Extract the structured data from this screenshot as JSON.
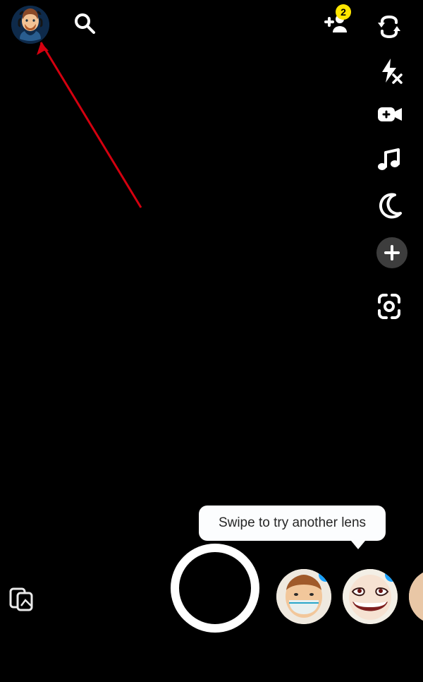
{
  "topbar": {
    "notification_count": "2"
  },
  "icons": {
    "search": "search-icon",
    "add_friend": "add-friend-icon",
    "flip": "flip-camera-icon",
    "flash": "flash-off-icon",
    "video": "video-plus-icon",
    "music": "music-icon",
    "night": "night-mode-icon",
    "plus": "plus-icon",
    "scan": "scan-icon",
    "memories": "memories-icon"
  },
  "tooltip": {
    "text": "Swipe to try another lens"
  },
  "lenses": [
    {
      "name": "face-mask-lens",
      "has_badge": true
    },
    {
      "name": "grin-lens",
      "has_badge": true
    },
    {
      "name": "skin-lens",
      "has_badge": false
    }
  ]
}
